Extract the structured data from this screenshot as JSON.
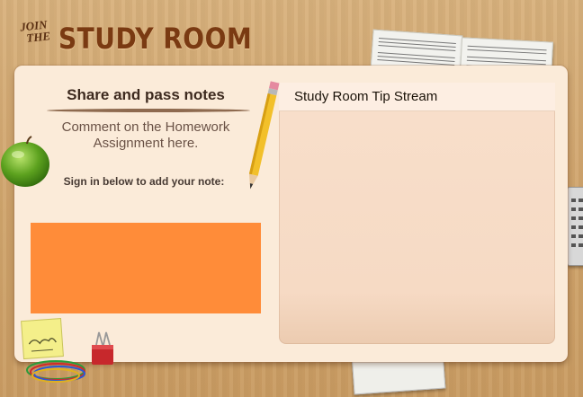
{
  "brand": {
    "join": "JOIN",
    "the": "THE",
    "title": "STUDY ROOM"
  },
  "left_pane": {
    "heading": "Share and pass notes",
    "subtitle": "Comment on the Homework Assignment here.",
    "signin_label": "Sign in below to add your note:"
  },
  "tip_stream": {
    "title": "Study Room Tip Stream"
  },
  "colors": {
    "signin_box": "#ff8c39",
    "panel": "#fbebd9",
    "brand": "#7a3a12"
  },
  "icons": [
    "apple-icon",
    "pencil-icon",
    "sticky-note-icon",
    "binder-clip-icon",
    "rubber-bands-icon",
    "calculator-icon",
    "sheet-music-icon",
    "book-icon"
  ]
}
